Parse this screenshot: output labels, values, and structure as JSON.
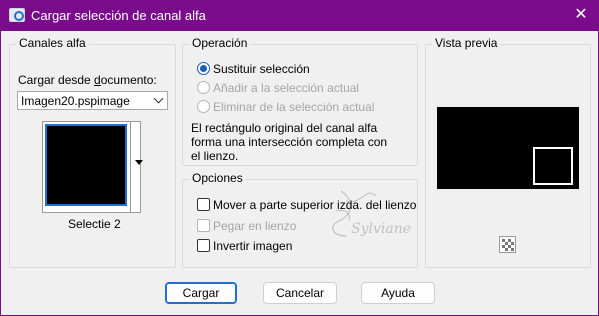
{
  "window": {
    "title": "Cargar selección de canal alfa",
    "close_glyph": "✕"
  },
  "channels": {
    "group_title": "Canales alfa",
    "load_from_label": "Cargar desde documento:",
    "document_value": "Imagen20.pspimage",
    "selection_name": "Selectie 2"
  },
  "operation": {
    "group_title": "Operación",
    "options": [
      {
        "label": "Sustituir selección",
        "checked": true,
        "enabled": true
      },
      {
        "label": "Añadir a la selección actual",
        "checked": false,
        "enabled": false
      },
      {
        "label": "Eliminar de la selección actual",
        "checked": false,
        "enabled": false
      }
    ],
    "description": [
      "El rectángulo original del canal alfa",
      "forma una intersección completa con",
      "el lienzo."
    ]
  },
  "options": {
    "group_title": "Opciones",
    "items": [
      {
        "label": "Mover a parte superior izda. del lienzo",
        "checked": false,
        "enabled": true
      },
      {
        "label": "Pegar en lienzo",
        "checked": false,
        "enabled": false
      },
      {
        "label": "Invertir imagen",
        "checked": false,
        "enabled": true
      }
    ]
  },
  "preview": {
    "group_title": "Vista previa"
  },
  "buttons": {
    "load": "Cargar",
    "cancel": "Cancelar",
    "help": "Ayuda"
  },
  "watermark": {
    "text": "Sylviane"
  },
  "colors": {
    "titlebar": "#7a0c8c",
    "accent": "#1e6fd1",
    "dialog_bg": "#f0f0f0"
  }
}
